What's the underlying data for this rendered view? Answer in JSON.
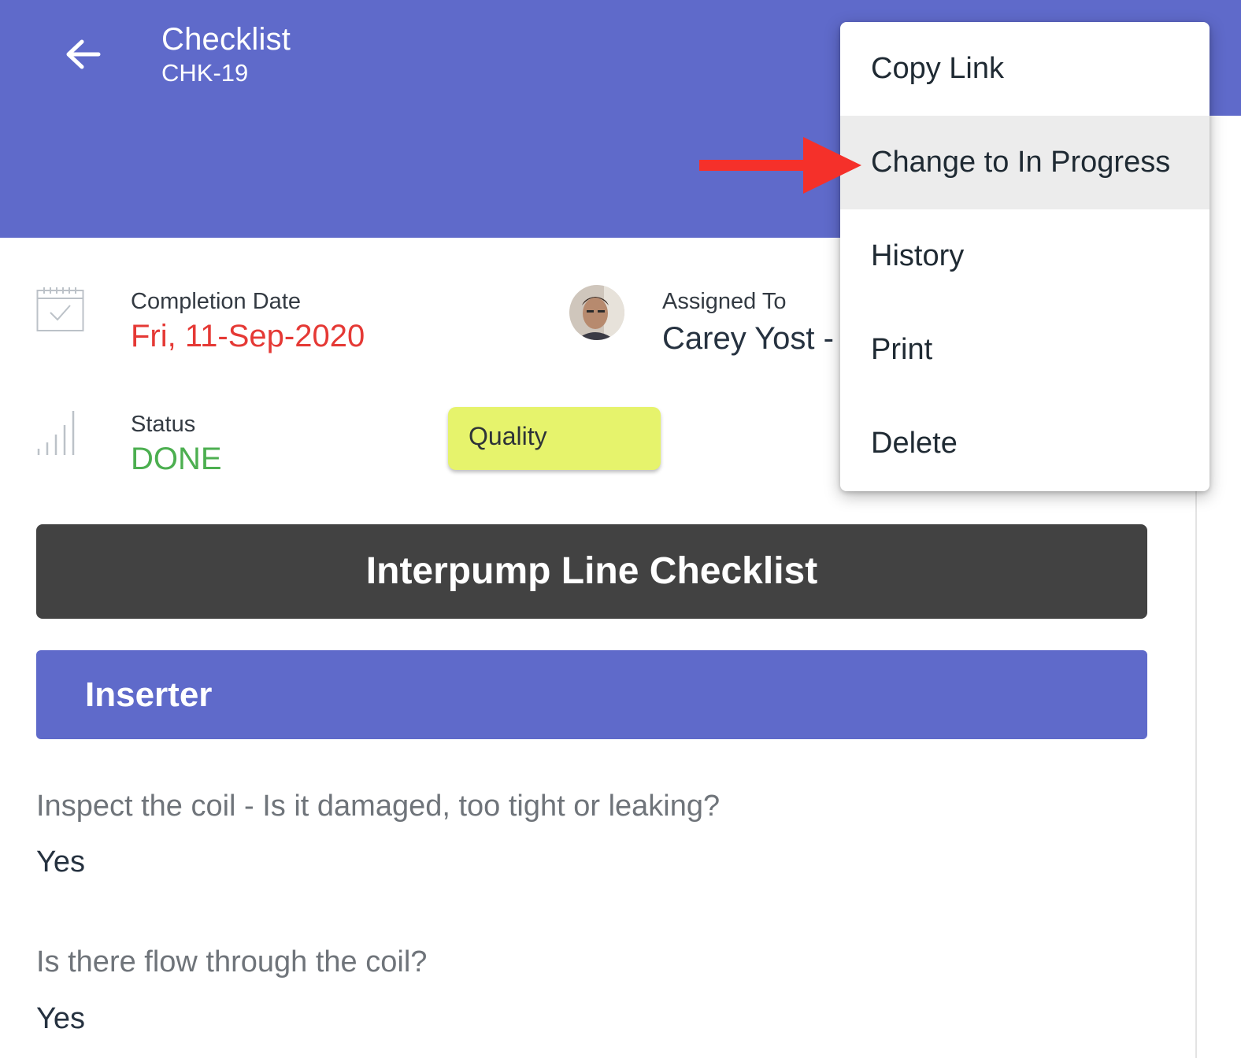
{
  "header": {
    "title": "Checklist",
    "subtitle": "CHK-19"
  },
  "fields": {
    "completion_date": {
      "label": "Completion Date",
      "value": "Fri, 11-Sep-2020",
      "color": "#e53935"
    },
    "assigned_to": {
      "label": "Assigned To",
      "value": "Carey Yost - I"
    },
    "status": {
      "label": "Status",
      "value": "DONE",
      "color": "#4caf50"
    },
    "tag": "Quality"
  },
  "checklist": {
    "title": "Interpump Line Checklist",
    "section": "Inserter",
    "items": [
      {
        "question": "Inspect the coil - Is it damaged, too tight or leaking?",
        "answer": "Yes"
      },
      {
        "question": "Is there flow through the coil?",
        "answer": "Yes"
      }
    ]
  },
  "menu": {
    "items": [
      {
        "label": "Copy Link"
      },
      {
        "label": "Change to In Progress",
        "highlighted": true
      },
      {
        "label": "History"
      },
      {
        "label": "Print"
      },
      {
        "label": "Delete"
      }
    ]
  },
  "colors": {
    "header": "#5f6aca",
    "banner": "#424242",
    "tag": "#e6f36c",
    "annotation_arrow": "#f5302a"
  },
  "icons": {
    "back": "arrow-left-icon",
    "calendar": "calendar-check-icon",
    "status": "signal-bars-icon"
  }
}
